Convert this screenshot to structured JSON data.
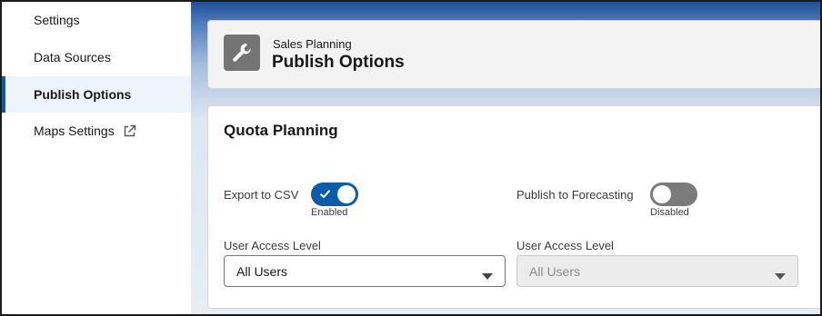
{
  "sidebar": {
    "items": [
      {
        "label": "Settings"
      },
      {
        "label": "Data Sources"
      },
      {
        "label": "Publish Options",
        "active": true
      },
      {
        "label": "Maps Settings",
        "icon": "external-link-icon"
      }
    ]
  },
  "header": {
    "icon": "wrench-icon",
    "subtitle": "Sales Planning",
    "title": "Publish Options"
  },
  "section": {
    "title": "Quota Planning",
    "export_csv": {
      "label": "Export to CSV",
      "state_label": "Enabled",
      "enabled": true
    },
    "publish_forecasting": {
      "label": "Publish to Forecasting",
      "state_label": "Disabled",
      "enabled": false
    },
    "access_left": {
      "label": "User Access Level",
      "value": "All Users",
      "disabled": false
    },
    "access_right": {
      "label": "User Access Level",
      "value": "All Users",
      "disabled": true
    }
  },
  "colors": {
    "accent": "#0b5cab",
    "toggle_off": "#7b7b7b",
    "header_gradient_top": "#1f4f96"
  }
}
